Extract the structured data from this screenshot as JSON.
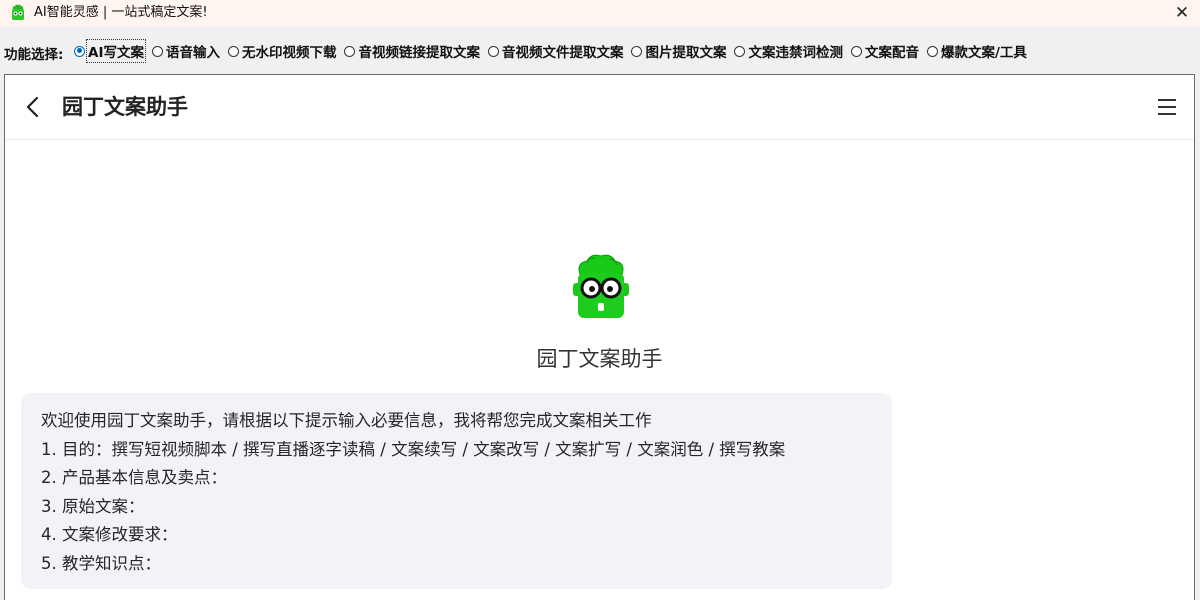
{
  "window": {
    "title": "AI智能灵感 | 一站式稿定文案!",
    "close_symbol": "✕",
    "logo_icon": "green-robot-logo-icon"
  },
  "function_bar": {
    "label": "功能选择:",
    "options": [
      {
        "label": "AI写文案",
        "selected": true
      },
      {
        "label": "语音输入",
        "selected": false
      },
      {
        "label": "无水印视频下载",
        "selected": false
      },
      {
        "label": "音视频链接提取文案",
        "selected": false
      },
      {
        "label": "音视频文件提取文案",
        "selected": false
      },
      {
        "label": "图片提取文案",
        "selected": false
      },
      {
        "label": "文案违禁词检测",
        "selected": false
      },
      {
        "label": "文案配音",
        "selected": false
      },
      {
        "label": "爆款文案/工具",
        "selected": false
      }
    ]
  },
  "chat": {
    "header_title": "园丁文案助手",
    "back_icon": "chevron-left-icon",
    "menu_icon": "hamburger-menu-icon",
    "bot_name": "园丁文案助手",
    "accent_color": "#1dcc1d",
    "welcome_lines": [
      "欢迎使用园丁文案助手，请根据以下提示输入必要信息，我将帮您完成文案相关工作",
      "1. 目的：撰写短视频脚本 / 撰写直播逐字读稿 / 文案续写 / 文案改写 / 文案扩写 / 文案润色 / 撰写教案",
      "2. 产品基本信息及卖点：",
      "3. 原始文案：",
      "4. 文案修改要求：",
      "5. 教学知识点："
    ]
  }
}
